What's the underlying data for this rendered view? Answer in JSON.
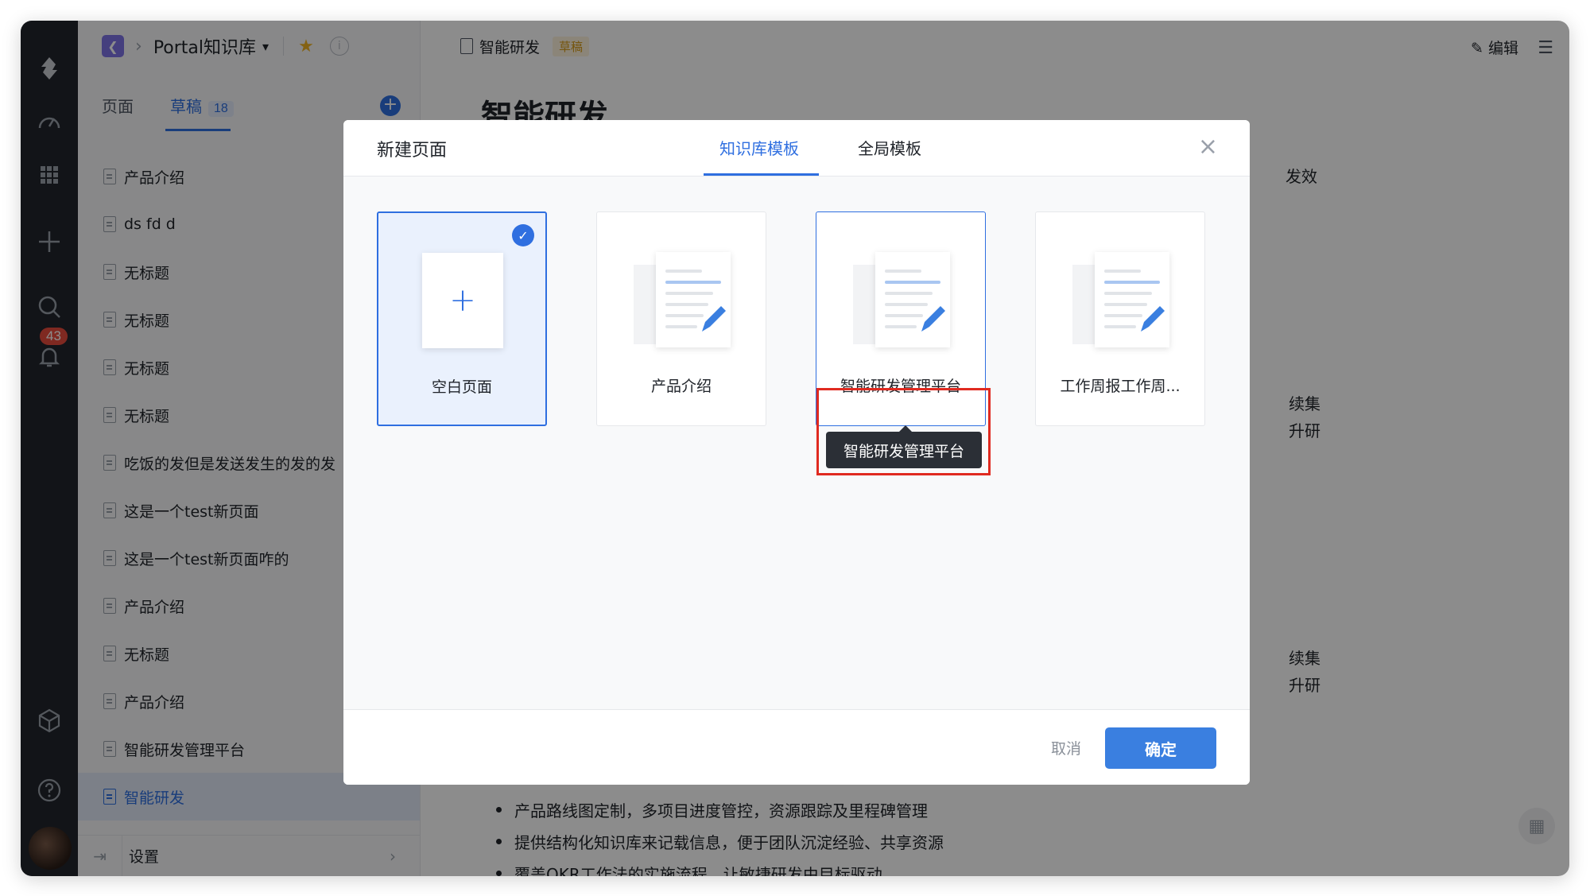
{
  "rail": {
    "notification_count": "43"
  },
  "sidebar": {
    "kb_name": "Portal知识库",
    "tabs": {
      "pages": "页面",
      "drafts": "草稿",
      "drafts_count": "18"
    },
    "items": [
      "产品介绍",
      "ds fd d",
      "无标题",
      "无标题",
      "无标题",
      "无标题",
      "吃饭的发但是发送发生的发的发",
      "这是一个test新页面",
      "这是一个test新页面咋的",
      "产品介绍",
      "无标题",
      "产品介绍",
      "智能研发管理平台",
      "智能研发"
    ],
    "settings_label": "设置"
  },
  "main": {
    "doc_title": "智能研发",
    "draft_tag": "草稿",
    "edit_label": "编辑",
    "heading": "智能研发",
    "fragments": [
      "发效",
      "续集",
      "升研",
      "续集",
      "升研"
    ],
    "bullets": [
      "产品路线图定制，多项目进度管控，资源跟踪及里程碑管理",
      "提供结构化知识库来记载信息，便于团队沉淀经验、共享资源",
      "覆盖OKR工作法的实施流程，让敏捷研发由目标驱动"
    ]
  },
  "modal": {
    "title": "新建页面",
    "tabs": [
      "知识库模板",
      "全局模板"
    ],
    "templates": [
      {
        "label": "空白页面",
        "selected": true
      },
      {
        "label": "产品介绍",
        "selected": false
      },
      {
        "label": "智能研发管理平台",
        "selected": false
      },
      {
        "label": "工作周报工作周...",
        "selected": false
      }
    ],
    "tooltip": "智能研发管理平台",
    "cancel_label": "取消",
    "ok_label": "确定"
  },
  "colors": {
    "accent": "#2f6fe0",
    "rail_bg": "#22252c",
    "highlight": "#e02a20",
    "badge": "#e84c3d"
  }
}
